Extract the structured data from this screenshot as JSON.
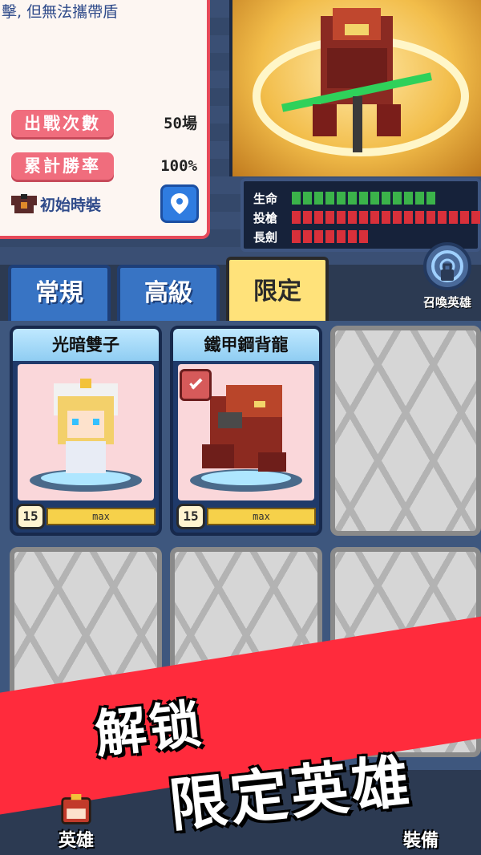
{
  "info": {
    "description": "擊, 但無法攜帶盾",
    "battles_label": "出戰次數",
    "battles_value": "50場",
    "winrate_label": "累計勝率",
    "winrate_value": "100%",
    "costume_label": "初始時裝"
  },
  "stats": [
    {
      "label": "生命",
      "filled": 13,
      "total": 13,
      "color": "#3bb34a"
    },
    {
      "label": "投槍",
      "filled": 17,
      "total": 17,
      "color": "#d8303a"
    },
    {
      "label": "長劍",
      "filled": 7,
      "total": 7,
      "color": "#d8303a"
    }
  ],
  "summon_label": "召喚英雄",
  "tabs": [
    {
      "label": "常規",
      "active": false
    },
    {
      "label": "高級",
      "active": false
    },
    {
      "label": "限定",
      "active": true
    }
  ],
  "heroes": [
    {
      "name": "光暗雙子",
      "level": "15",
      "level_text": "max"
    },
    {
      "name": "鐵甲鋼背龍",
      "level": "15",
      "level_text": "max"
    }
  ],
  "promo": {
    "line1": "解锁",
    "line2": "限定英雄"
  },
  "nav": [
    {
      "label": "英雄"
    },
    {
      "label": "裝備"
    }
  ],
  "colors": {
    "accent_red": "#ff2b3c",
    "tab_active": "#ffe27a",
    "tab_inactive": "#3874c4"
  }
}
